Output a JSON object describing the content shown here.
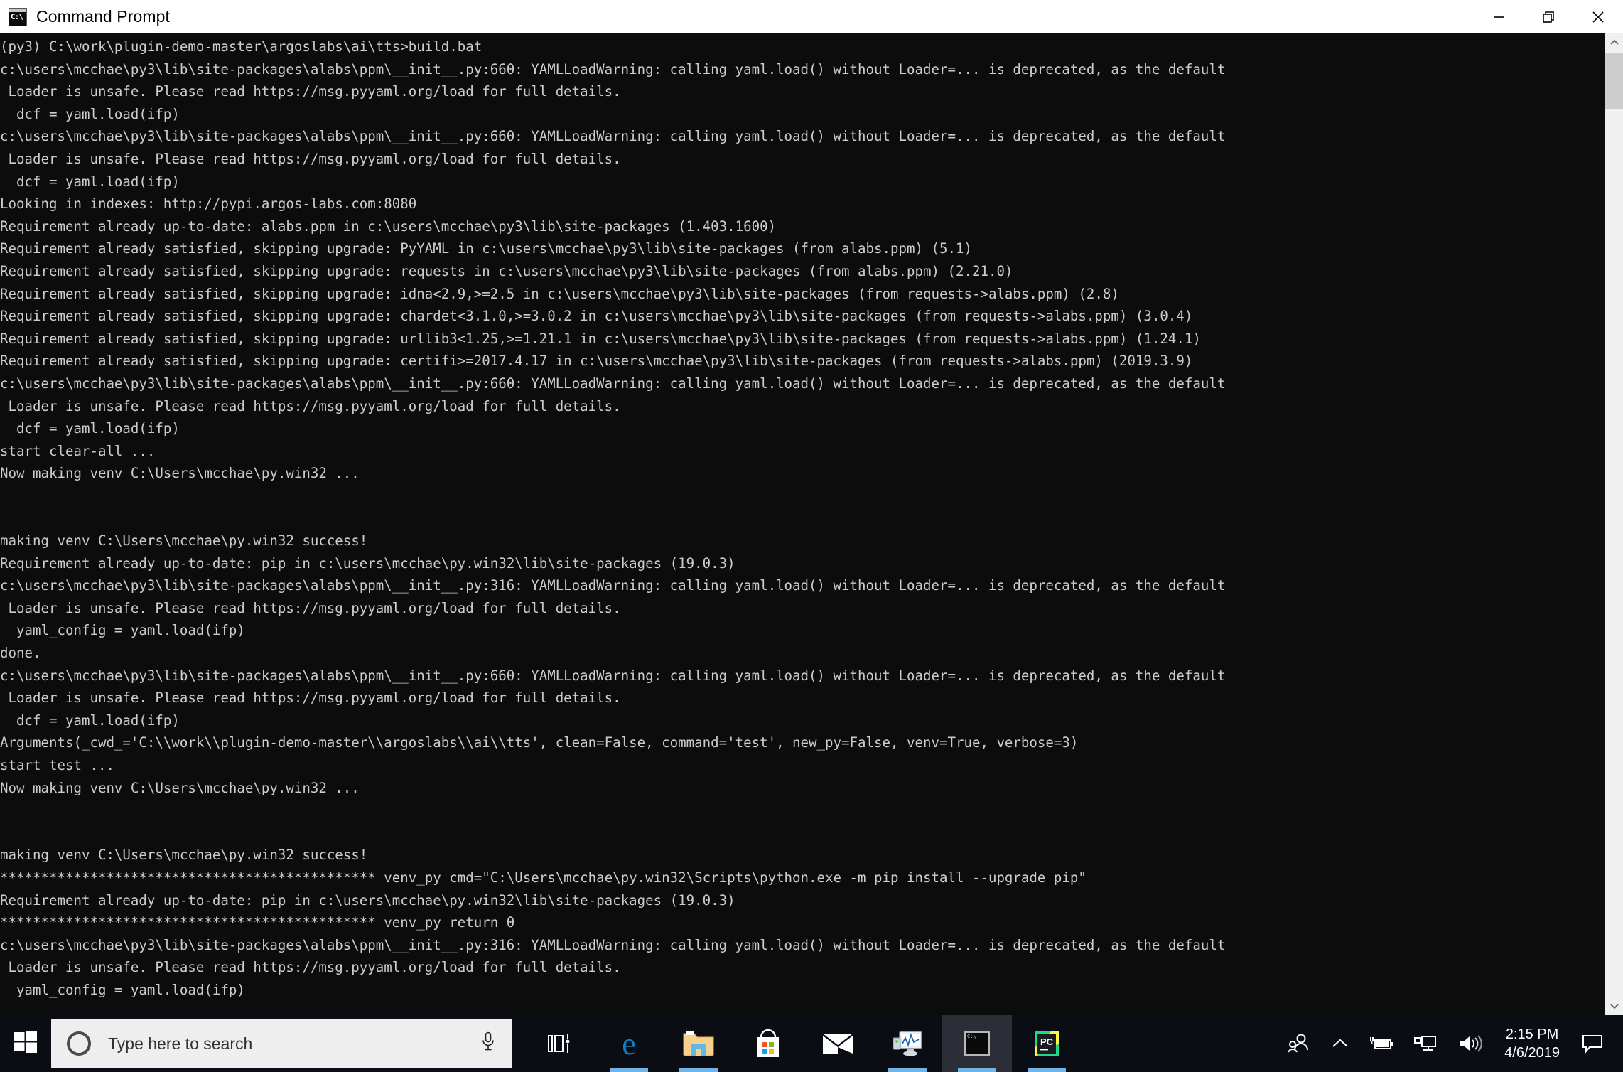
{
  "window": {
    "title": "Command Prompt",
    "icon": "console-icon",
    "icon_text": "C:\\",
    "controls": [
      {
        "name": "minimize-button",
        "glyph": "minimize-icon"
      },
      {
        "name": "restore-button",
        "glyph": "restore-icon"
      },
      {
        "name": "close-button",
        "glyph": "close-icon"
      }
    ]
  },
  "console": {
    "background": "#0c0c0c",
    "foreground": "#ccccc9",
    "text": "(py3) C:\\work\\plugin-demo-master\\argoslabs\\ai\\tts>build.bat\nc:\\users\\mcchae\\py3\\lib\\site-packages\\alabs\\ppm\\__init__.py:660: YAMLLoadWarning: calling yaml.load() without Loader=... is deprecated, as the default\n Loader is unsafe. Please read https://msg.pyyaml.org/load for full details.\n  dcf = yaml.load(ifp)\nc:\\users\\mcchae\\py3\\lib\\site-packages\\alabs\\ppm\\__init__.py:660: YAMLLoadWarning: calling yaml.load() without Loader=... is deprecated, as the default\n Loader is unsafe. Please read https://msg.pyyaml.org/load for full details.\n  dcf = yaml.load(ifp)\nLooking in indexes: http://pypi.argos-labs.com:8080\nRequirement already up-to-date: alabs.ppm in c:\\users\\mcchae\\py3\\lib\\site-packages (1.403.1600)\nRequirement already satisfied, skipping upgrade: PyYAML in c:\\users\\mcchae\\py3\\lib\\site-packages (from alabs.ppm) (5.1)\nRequirement already satisfied, skipping upgrade: requests in c:\\users\\mcchae\\py3\\lib\\site-packages (from alabs.ppm) (2.21.0)\nRequirement already satisfied, skipping upgrade: idna<2.9,>=2.5 in c:\\users\\mcchae\\py3\\lib\\site-packages (from requests->alabs.ppm) (2.8)\nRequirement already satisfied, skipping upgrade: chardet<3.1.0,>=3.0.2 in c:\\users\\mcchae\\py3\\lib\\site-packages (from requests->alabs.ppm) (3.0.4)\nRequirement already satisfied, skipping upgrade: urllib3<1.25,>=1.21.1 in c:\\users\\mcchae\\py3\\lib\\site-packages (from requests->alabs.ppm) (1.24.1)\nRequirement already satisfied, skipping upgrade: certifi>=2017.4.17 in c:\\users\\mcchae\\py3\\lib\\site-packages (from requests->alabs.ppm) (2019.3.9)\nc:\\users\\mcchae\\py3\\lib\\site-packages\\alabs\\ppm\\__init__.py:660: YAMLLoadWarning: calling yaml.load() without Loader=... is deprecated, as the default\n Loader is unsafe. Please read https://msg.pyyaml.org/load for full details.\n  dcf = yaml.load(ifp)\nstart clear-all ...\nNow making venv C:\\Users\\mcchae\\py.win32 ...\n\n\nmaking venv C:\\Users\\mcchae\\py.win32 success!\nRequirement already up-to-date: pip in c:\\users\\mcchae\\py.win32\\lib\\site-packages (19.0.3)\nc:\\users\\mcchae\\py3\\lib\\site-packages\\alabs\\ppm\\__init__.py:316: YAMLLoadWarning: calling yaml.load() without Loader=... is deprecated, as the default\n Loader is unsafe. Please read https://msg.pyyaml.org/load for full details.\n  yaml_config = yaml.load(ifp)\ndone.\nc:\\users\\mcchae\\py3\\lib\\site-packages\\alabs\\ppm\\__init__.py:660: YAMLLoadWarning: calling yaml.load() without Loader=... is deprecated, as the default\n Loader is unsafe. Please read https://msg.pyyaml.org/load for full details.\n  dcf = yaml.load(ifp)\nArguments(_cwd_='C:\\\\work\\\\plugin-demo-master\\\\argoslabs\\\\ai\\\\tts', clean=False, command='test', new_py=False, venv=True, verbose=3)\nstart test ...\nNow making venv C:\\Users\\mcchae\\py.win32 ...\n\n\nmaking venv C:\\Users\\mcchae\\py.win32 success!\n********************************************** venv_py cmd=\"C:\\Users\\mcchae\\py.win32\\Scripts\\python.exe -m pip install --upgrade pip\"\nRequirement already up-to-date: pip in c:\\users\\mcchae\\py.win32\\lib\\site-packages (19.0.3)\n********************************************** venv_py return 0\nc:\\users\\mcchae\\py3\\lib\\site-packages\\alabs\\ppm\\__init__.py:316: YAMLLoadWarning: calling yaml.load() without Loader=... is deprecated, as the default\n Loader is unsafe. Please read https://msg.pyyaml.org/load for full details.\n  yaml_config = yaml.load(ifp)"
  },
  "scrollbar": {
    "up_arrow": "chevron-up-icon",
    "down_arrow": "chevron-down-icon"
  },
  "taskbar": {
    "start": "windows-logo-icon",
    "search": {
      "icon": "cortana-circle-icon",
      "placeholder": "Type here to search",
      "mic": "microphone-icon"
    },
    "pinned": [
      {
        "name": "task-view-button",
        "label": "Task View",
        "icon": "task-view-icon",
        "active": false,
        "running": false
      },
      {
        "name": "taskbar-edge",
        "label": "Microsoft Edge",
        "icon": "edge-icon",
        "active": false,
        "running": true
      },
      {
        "name": "taskbar-file-explorer",
        "label": "File Explorer",
        "icon": "folder-icon",
        "active": false,
        "running": true
      },
      {
        "name": "taskbar-store",
        "label": "Microsoft Store",
        "icon": "store-bag-icon",
        "active": false,
        "running": false
      },
      {
        "name": "taskbar-mail",
        "label": "Mail",
        "icon": "envelope-icon",
        "active": false,
        "running": false
      },
      {
        "name": "taskbar-task-manager",
        "label": "Task Manager",
        "icon": "monitor-chart-icon",
        "active": false,
        "running": true
      },
      {
        "name": "taskbar-command-prompt",
        "label": "Command Prompt",
        "icon": "console-window-icon",
        "active": true,
        "running": true
      },
      {
        "name": "taskbar-pycharm",
        "label": "PyCharm",
        "icon": "pycharm-icon",
        "active": false,
        "running": true
      }
    ],
    "tray": [
      {
        "name": "people-button",
        "icon": "people-icon"
      },
      {
        "name": "show-hidden-icons-button",
        "icon": "chevron-up-icon"
      },
      {
        "name": "battery-button",
        "icon": "battery-charging-icon"
      },
      {
        "name": "network-button",
        "icon": "network-monitor-icon"
      },
      {
        "name": "volume-button",
        "icon": "speaker-icon"
      }
    ],
    "clock": {
      "time": "2:15 PM",
      "date": "4/6/2019"
    },
    "action_center": "notification-icon"
  }
}
